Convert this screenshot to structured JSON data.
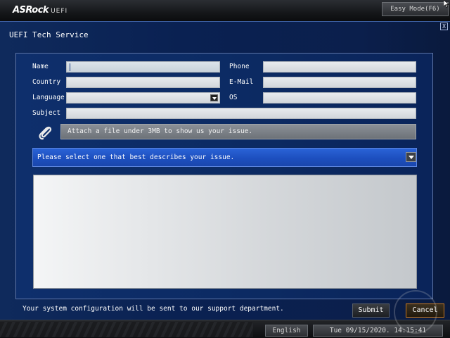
{
  "header": {
    "logo": "ASRock",
    "logo_suffix": "UEFI",
    "easy_mode_label": "Easy Mode(F6)"
  },
  "dialog": {
    "title": "UEFI Tech Service",
    "close_label": "X"
  },
  "form": {
    "name_label": "Name",
    "name_value": "",
    "phone_label": "Phone",
    "phone_value": "",
    "country_label": "Country",
    "country_value": "",
    "email_label": "E-Mail",
    "email_value": "",
    "language_label": "Language",
    "language_value": "",
    "os_label": "OS",
    "os_value": "",
    "subject_label": "Subject",
    "subject_value": "",
    "attach_label": "Attach a file under 3MB to show us your issue.",
    "issue_select_label": "Please select one that best describes your issue.",
    "message_value": ""
  },
  "footer": {
    "note": "Your system configuration will be sent to our support department.",
    "submit_label": "Submit",
    "cancel_label": "Cancel"
  },
  "statusbar": {
    "language": "English",
    "datetime": "Tue 09/15/2020. 14:15:41"
  },
  "colors": {
    "dialog_bg": "#0b2352",
    "selector_blue": "#1d4fbf",
    "cancel_accent": "#c8791f"
  },
  "icons": {
    "attach": "paperclip-icon",
    "dropdown": "chevron-down-icon",
    "cursor": "mouse-pointer-icon"
  }
}
